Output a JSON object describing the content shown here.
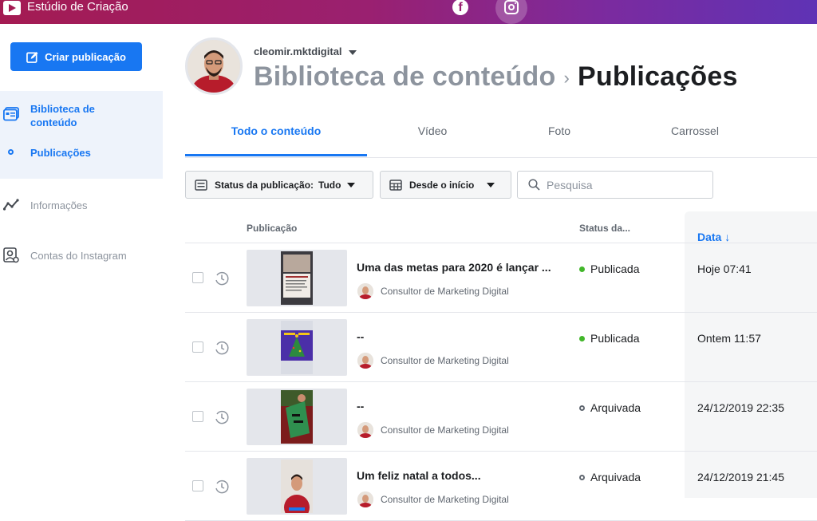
{
  "app": {
    "title": "Estúdio de Criação"
  },
  "topbar": {
    "icons": [
      "facebook-icon",
      "instagram-icon"
    ],
    "gradient": [
      "#a41b52",
      "#5f33b5"
    ]
  },
  "sidebar": {
    "create_label": "Criar publicação",
    "library_label": "Biblioteca de conteúdo",
    "publications_label": "Publicações",
    "insights_label": "Informações",
    "instagram_accounts_label": "Contas do Instagram"
  },
  "header": {
    "account": "cleomir.mktdigital",
    "crumb_parent": "Biblioteca de conteúdo",
    "crumb_current": "Publicações"
  },
  "tabs": [
    {
      "label": "Todo o conteúdo",
      "active": true
    },
    {
      "label": "Vídeo",
      "active": false
    },
    {
      "label": "Foto",
      "active": false
    },
    {
      "label": "Carrossel",
      "active": false
    }
  ],
  "filters": {
    "status_label": "Status da publicação:",
    "status_value": "Tudo",
    "date_label": "Desde o início",
    "search_placeholder": "Pesquisa"
  },
  "table": {
    "columns": {
      "publication": "Publicação",
      "status": "Status da...",
      "date": "Data ↓"
    },
    "rows": [
      {
        "title": "Uma das metas para 2020 é lançar ...",
        "author": "Consultor de Marketing Digital",
        "status": "Publicada",
        "status_kind": "published",
        "date": "Hoje 07:41"
      },
      {
        "title": "--",
        "author": "Consultor de Marketing Digital",
        "status": "Publicada",
        "status_kind": "published",
        "date": "Ontem 11:57"
      },
      {
        "title": "--",
        "author": "Consultor de Marketing Digital",
        "status": "Arquivada",
        "status_kind": "archived",
        "date": "24/12/2019 22:35"
      },
      {
        "title": "Um feliz natal a todos...",
        "author": "Consultor de Marketing Digital",
        "status": "Arquivada",
        "status_kind": "archived",
        "date": "24/12/2019 21:45"
      }
    ]
  },
  "colors": {
    "accent": "#1877f2",
    "published": "#42b72a",
    "archived": "#606770"
  }
}
